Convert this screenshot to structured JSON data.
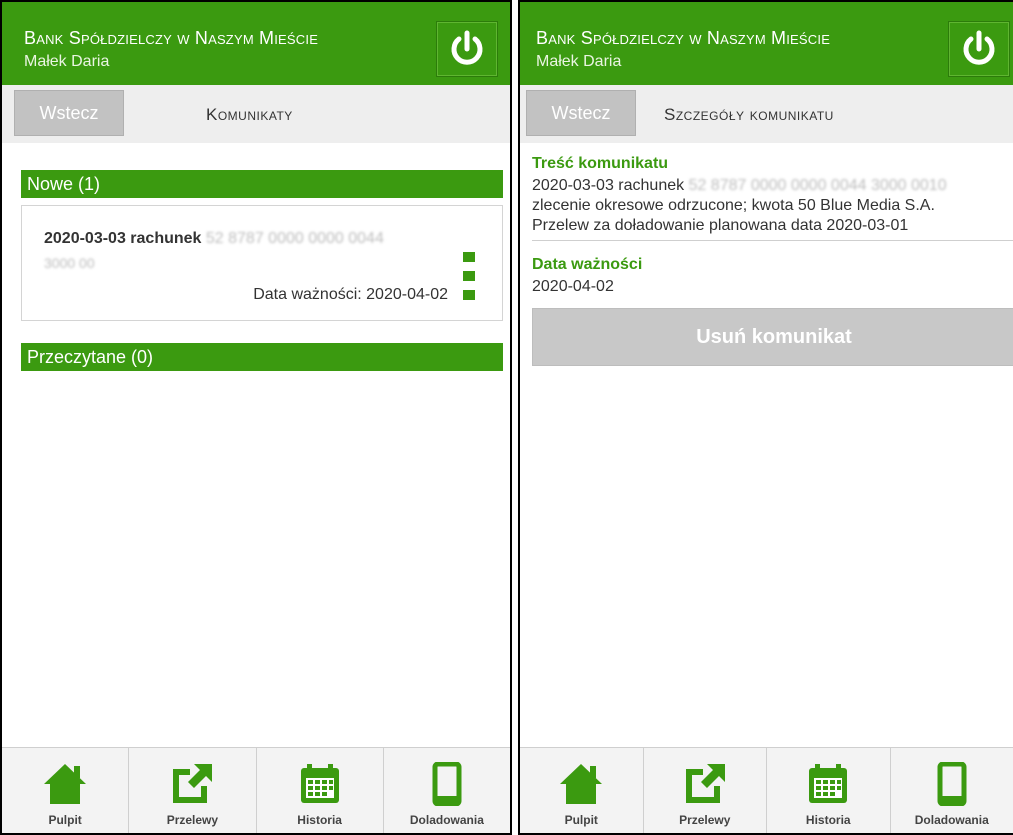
{
  "header": {
    "bank_name": "Bank Spółdzielczy w Naszym Mieście",
    "user_name": "Małek Daria"
  },
  "left_screen": {
    "back_label": "Wstecz",
    "title": "Komunikaty",
    "section_new": "Nowe (1)",
    "message": {
      "line1_prefix": "2020-03-03 rachunek",
      "line1_blurred": "52 8787 0000 0000 0044",
      "line2_blurred": "3000 00",
      "validity": "Data ważności: 2020-04-02"
    },
    "section_read": "Przeczytane (0)"
  },
  "right_screen": {
    "back_label": "Wstecz",
    "title": "Szczegóły komunikatu",
    "content_label": "Treść komunikatu",
    "content_line1_prefix": "2020-03-03 rachunek",
    "content_line1_blurred": "52 8787 0000 0000 0044 3000 0010",
    "content_line2": "zlecenie okresowe odrzucone; kwota 50 Blue Media S.A.",
    "content_line3": "Przelew za doładowanie planowana data 2020-03-01",
    "validity_label": "Data ważności",
    "validity_value": "2020-04-02",
    "delete_label": "Usuń komunikat"
  },
  "bottom_nav": {
    "items": [
      {
        "label": "Pulpit",
        "icon": "home-icon"
      },
      {
        "label": "Przelewy",
        "icon": "transfer-icon"
      },
      {
        "label": "Historia",
        "icon": "calendar-icon"
      },
      {
        "label": "Doladowania",
        "icon": "phone-icon"
      }
    ]
  },
  "colors": {
    "brand_green": "#3b9a10",
    "button_gray": "#c2c2c2"
  }
}
